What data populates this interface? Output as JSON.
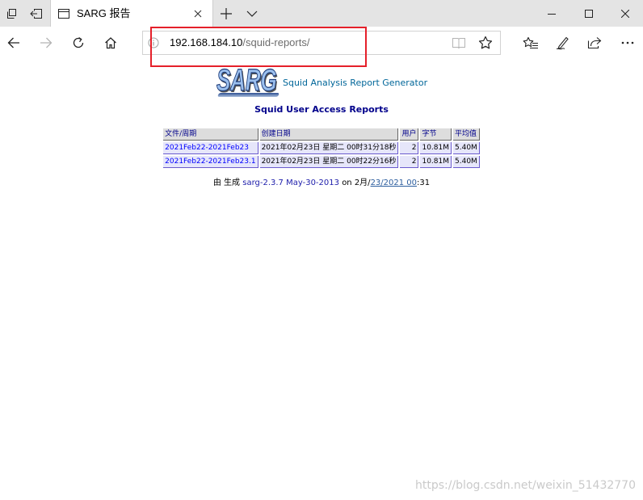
{
  "browser": {
    "tabs": [
      {
        "title": "SARG 报告"
      }
    ],
    "address": {
      "host": "192.168.184.10",
      "path": "/squid-reports/"
    }
  },
  "icons": {
    "tabs_aside": "tabs-aside-icon",
    "set_tabs_aside": "set-tabs-aside-icon",
    "tab_page": "page-icon",
    "tab_close": "close-icon",
    "new_tab": "plus-icon",
    "tab_list": "chevron-down-icon",
    "minimize": "minimize-icon",
    "maximize": "maximize-icon",
    "window_close": "close-icon",
    "back": "arrow-left-icon",
    "forward": "arrow-right-icon",
    "refresh": "refresh-icon",
    "home": "home-icon",
    "site_info": "info-icon",
    "reading_view": "book-icon",
    "add_favorite": "star-icon",
    "hub": "favorites-hub-icon",
    "web_notes": "pen-icon",
    "share": "share-icon",
    "more": "more-dots-icon"
  },
  "page": {
    "logo_text": "SARG",
    "generator_link": "Squid Analysis Report Generator",
    "title": "Squid User Access Reports",
    "table": {
      "headers": [
        "文件/周期",
        "创建日期",
        "用户",
        "字节",
        "平均值"
      ],
      "rows": [
        [
          "2021Feb22-2021Feb23",
          "2021年02月23日 星期二 00时31分18秒",
          "2",
          "10.81M",
          "5.40M"
        ],
        [
          "2021Feb22-2021Feb23.1",
          "2021年02月23日 星期二 00时22分16秒",
          "2",
          "10.81M",
          "5.40M"
        ]
      ]
    },
    "footer": {
      "text_before": "由 生成",
      "version_link": "sarg-2.3.7 May-30-2013",
      "text_middle": "on 2月/",
      "date_link": "23/2021 00",
      "text_after": ":31"
    }
  },
  "watermark": "https://blog.csdn.net/weixin_51432770",
  "colors": {
    "generator_link": "#006699",
    "title": "#00008b",
    "header_bg": "#dddddd",
    "row_bg": "#e6e6fa",
    "row_border": "#6a5acd",
    "report_link": "#0000ff",
    "annotation": "#e5202a"
  }
}
